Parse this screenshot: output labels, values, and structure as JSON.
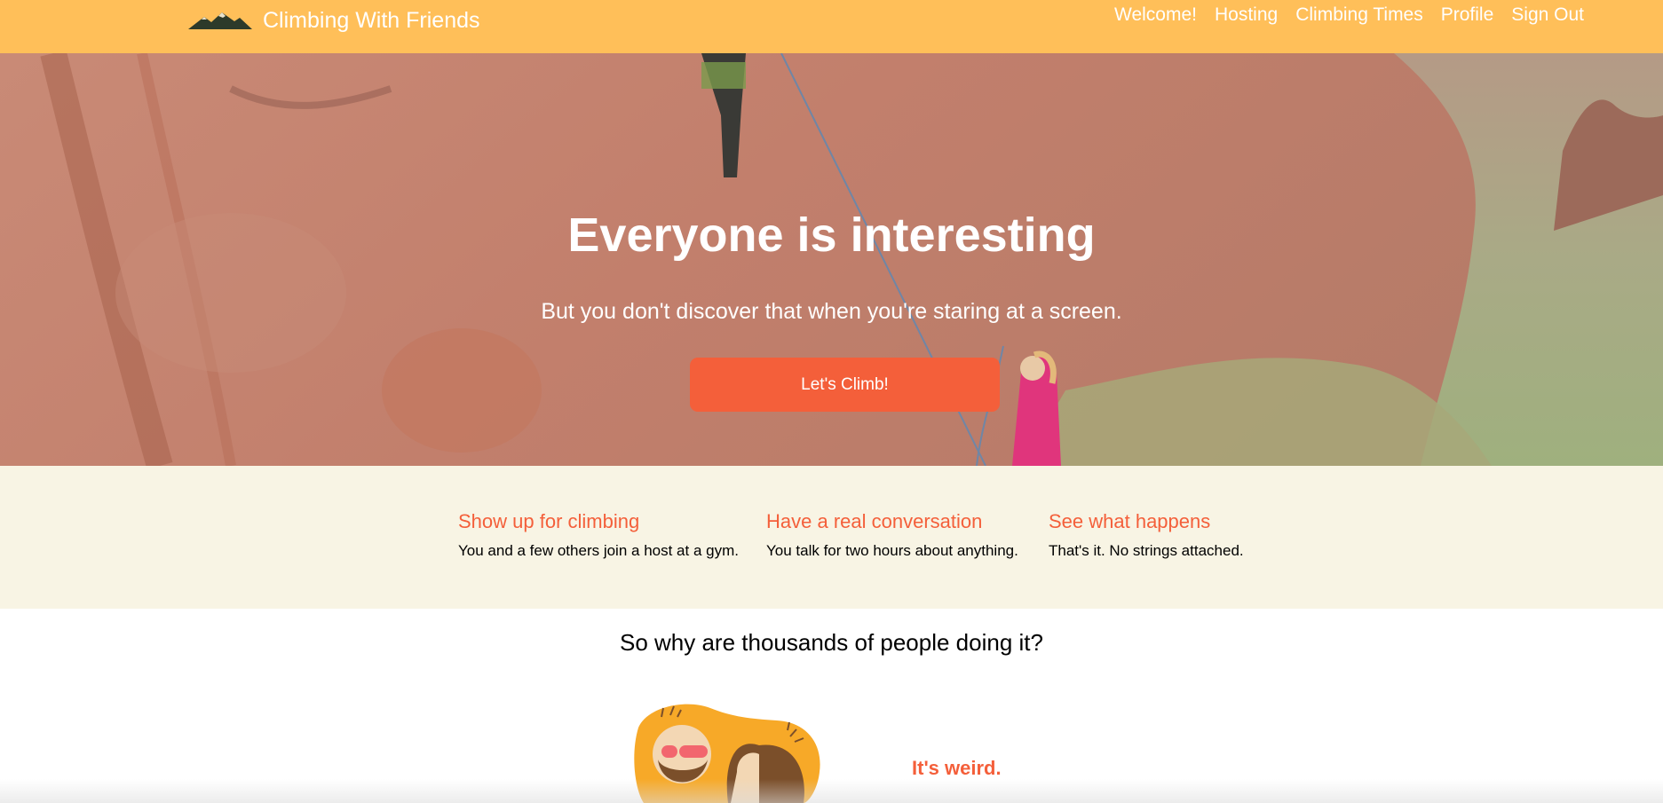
{
  "nav": {
    "brand": "Climbing With Friends",
    "logo_icon": "mountain-logo-icon",
    "links": [
      "Welcome!",
      "Hosting",
      "Climbing Times",
      "Profile",
      "Sign Out"
    ]
  },
  "hero": {
    "title": "Everyone is interesting",
    "subtitle": "But you don't discover that when you're staring at a screen.",
    "cta": "Let's Climb!"
  },
  "steps": [
    {
      "title": "Show up for climbing",
      "text": "You and a few others join a host at a gym."
    },
    {
      "title": "Have a real conversation",
      "text": "You talk for two hours about anything."
    },
    {
      "title": "See what happens",
      "text": "That's it. No strings attached."
    }
  ],
  "why": {
    "title": "So why are thousands of people doing it?",
    "reason": "It's weird."
  },
  "colors": {
    "nav": "#ffbf59",
    "accent": "#f45f3a",
    "steps_bg": "#f8f4e4"
  }
}
